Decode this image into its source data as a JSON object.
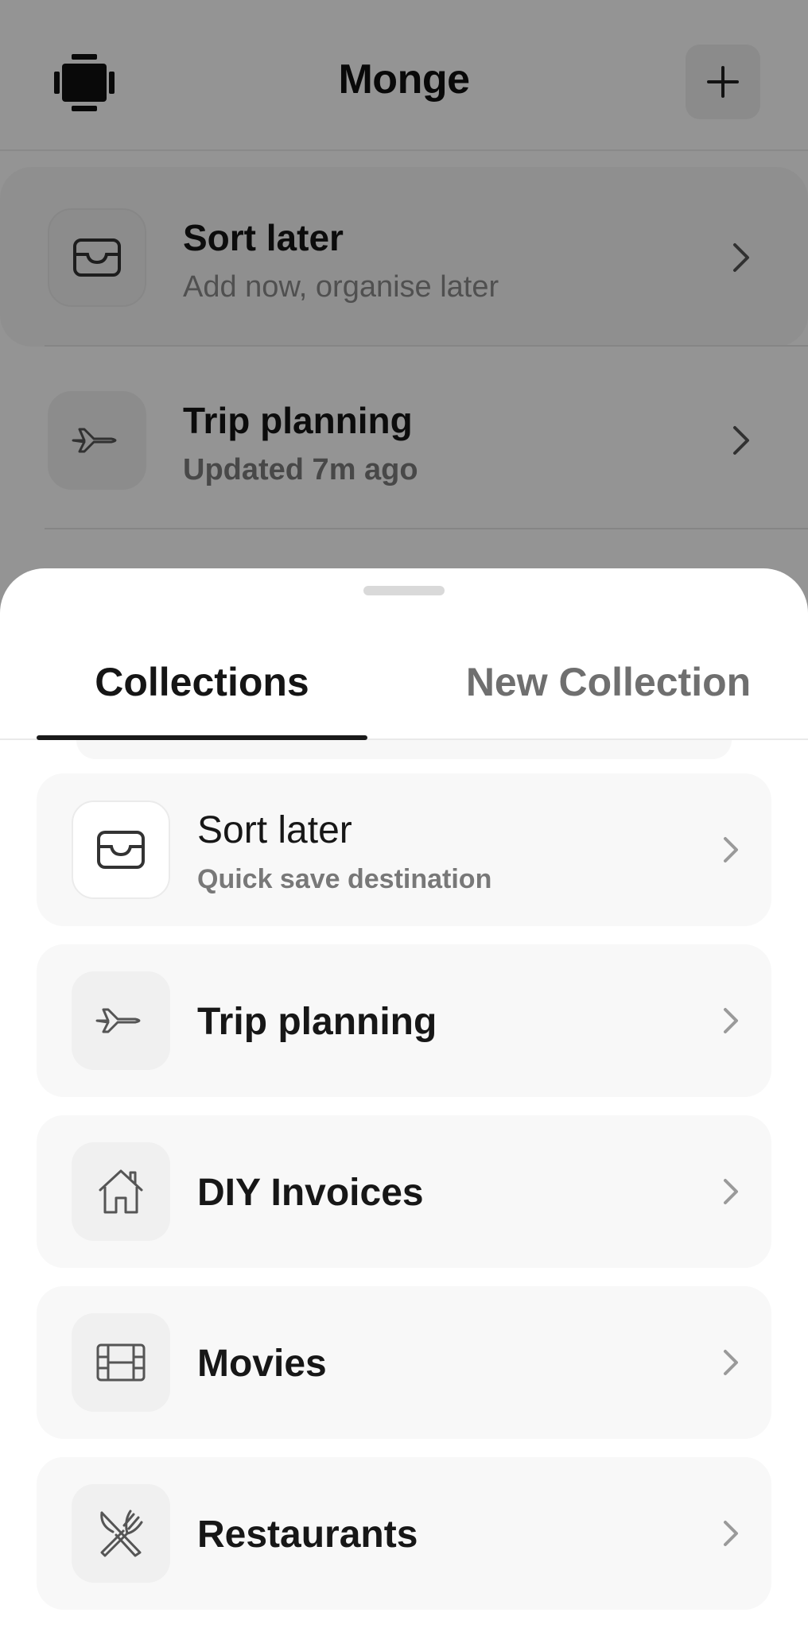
{
  "header": {
    "app_title": "Monge",
    "logo_icon": "film-frame-logo-icon",
    "add_icon": "plus-icon"
  },
  "background_list": [
    {
      "title": "Sort later",
      "subtitle": "Add now, organise later",
      "icon": "inbox-tray-icon"
    },
    {
      "title": "Trip planning",
      "subtitle": "Updated 7m ago",
      "icon": "airplane-icon"
    }
  ],
  "sheet": {
    "tabs": [
      {
        "label": "Collections",
        "active": true
      },
      {
        "label": "New Collection",
        "active": false
      }
    ],
    "collections": [
      {
        "title": "Sort later",
        "subtitle": "Quick save destination",
        "icon": "inbox-tray-icon"
      },
      {
        "title": "Trip planning",
        "icon": "airplane-icon"
      },
      {
        "title": "DIY Invoices",
        "icon": "house-icon"
      },
      {
        "title": "Movies",
        "icon": "film-strip-icon"
      },
      {
        "title": "Restaurants",
        "icon": "fork-knife-icon"
      }
    ]
  },
  "colors": {
    "overlay": "#000000",
    "text_primary": "#171717",
    "text_secondary": "#787878",
    "card_bg": "#f8f8f8"
  }
}
